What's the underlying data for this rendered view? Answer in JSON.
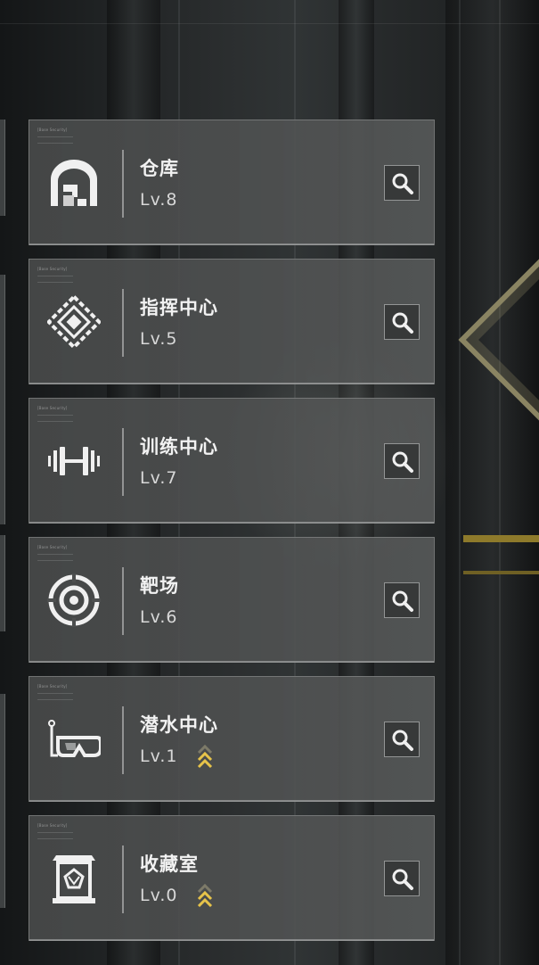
{
  "buildings": [
    {
      "name": "仓库",
      "level": "Lv.8",
      "tag": "[Base Security]",
      "icon": "warehouse-icon",
      "upgrade_available": false
    },
    {
      "name": "指挥中心",
      "level": "Lv.5",
      "tag": "[Base Security]",
      "icon": "command-center-icon",
      "upgrade_available": false
    },
    {
      "name": "训练中心",
      "level": "Lv.7",
      "tag": "[Base Security]",
      "icon": "training-center-icon",
      "upgrade_available": false
    },
    {
      "name": "靶场",
      "level": "Lv.6",
      "tag": "[Base Security]",
      "icon": "shooting-range-icon",
      "upgrade_available": false
    },
    {
      "name": "潜水中心",
      "level": "Lv.1",
      "tag": "[Base Security]",
      "icon": "diving-center-icon",
      "upgrade_available": true
    },
    {
      "name": "收藏室",
      "level": "Lv.0",
      "tag": "[Base Security]",
      "icon": "collection-room-icon",
      "upgrade_available": true
    }
  ],
  "colors": {
    "upgrade_arrow": "#e6c34a",
    "card_bg": "#4d4f4f",
    "text": "#f2f2f2"
  },
  "search_icon": "magnifier-icon"
}
